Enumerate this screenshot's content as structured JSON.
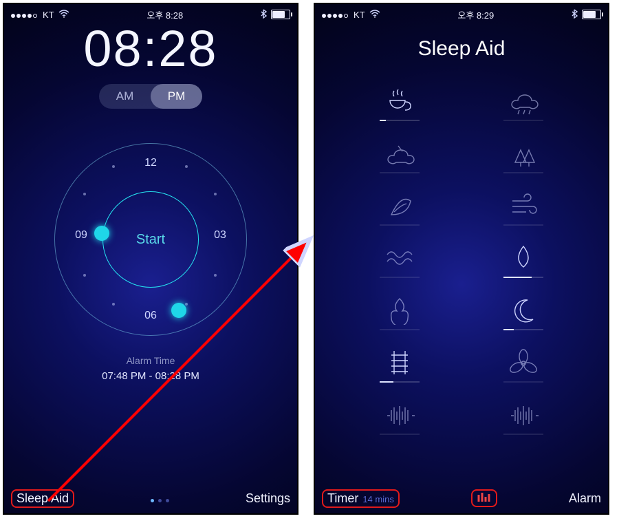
{
  "left": {
    "status": {
      "carrier": "KT",
      "time": "오후 8:28"
    },
    "clock": "08:28",
    "ampm": {
      "am": "AM",
      "pm": "PM",
      "active": "PM"
    },
    "dial": {
      "labels": {
        "twelve": "12",
        "three": "03",
        "six": "06",
        "nine": "09"
      },
      "center": "Start"
    },
    "alarm": {
      "label": "Alarm Time",
      "range": "07:48 PM - 08:28 PM"
    },
    "bottom": {
      "left": "Sleep Aid",
      "right": "Settings"
    }
  },
  "right": {
    "status": {
      "carrier": "KT",
      "time": "오후 8:29"
    },
    "title": "Sleep Aid",
    "sounds": [
      {
        "name": "coffee",
        "active": true,
        "level": 0.15
      },
      {
        "name": "rain",
        "active": false,
        "level": 0
      },
      {
        "name": "cloud",
        "active": false,
        "level": 0
      },
      {
        "name": "forest",
        "active": false,
        "level": 0
      },
      {
        "name": "leaf",
        "active": false,
        "level": 0
      },
      {
        "name": "wind",
        "active": false,
        "level": 0
      },
      {
        "name": "waves",
        "active": false,
        "level": 0
      },
      {
        "name": "drop",
        "active": true,
        "level": 0.7
      },
      {
        "name": "fire",
        "active": false,
        "level": 0
      },
      {
        "name": "moon",
        "active": true,
        "level": 0.25
      },
      {
        "name": "rail",
        "active": true,
        "level": 0.35
      },
      {
        "name": "fan",
        "active": false,
        "level": 0
      },
      {
        "name": "white-noise",
        "active": false,
        "level": 0
      },
      {
        "name": "pink-noise",
        "active": false,
        "level": 0
      }
    ],
    "bottom": {
      "left": "Timer",
      "timer_value": "14 mins",
      "right": "Alarm"
    }
  }
}
